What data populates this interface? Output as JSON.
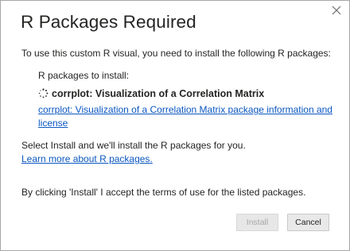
{
  "dialog": {
    "title": "R Packages Required",
    "intro": "To use this custom R visual, you need to install the following R packages:",
    "packages_label": "R packages to install:",
    "package": {
      "name": "corrplot: Visualization of a Correlation Matrix",
      "info_link_line1": "corrplot: Visualization of a Correlation Matrix package information and",
      "info_link_line2": "license"
    },
    "install_note": "Select Install and we'll install the R packages for you.",
    "learn_more_link": "Learn more about R packages.",
    "terms": "By clicking 'Install' I accept the terms of use for the listed packages.",
    "buttons": {
      "install": "Install",
      "cancel": "Cancel"
    },
    "icons": {
      "close": "close-icon",
      "loading": "loading-spinner-icon"
    },
    "colors": {
      "link": "#0b57c1",
      "text": "#252423",
      "disabled_text": "#a6a6a6"
    }
  }
}
